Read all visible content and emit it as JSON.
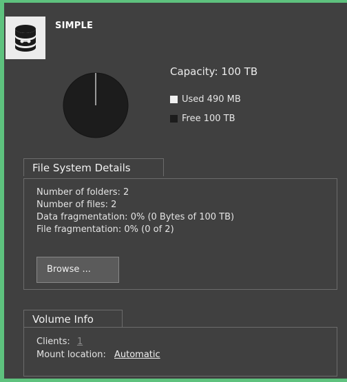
{
  "volume": {
    "name": "SIMPLE",
    "icon": "database-icon"
  },
  "capacity": {
    "label": "Capacity: 100 TB",
    "used_label": "Used 490 MB",
    "free_label": "Free 100 TB",
    "used_color": "#f0f0f0",
    "free_color": "#1c1c1c"
  },
  "file_system": {
    "title": "File System Details",
    "folders": "Number of folders: 2",
    "files": "Number of files: 2",
    "data_fragmentation": "Data fragmentation: 0% (0 Bytes of 100 TB)",
    "file_fragmentation": "File fragmentation: 0% (0 of 2)",
    "browse_label": "Browse ..."
  },
  "volume_info": {
    "title": "Volume Info",
    "clients_label": "Clients:",
    "clients_value": "1",
    "mount_label": "Mount location:",
    "mount_value": "Automatic"
  }
}
